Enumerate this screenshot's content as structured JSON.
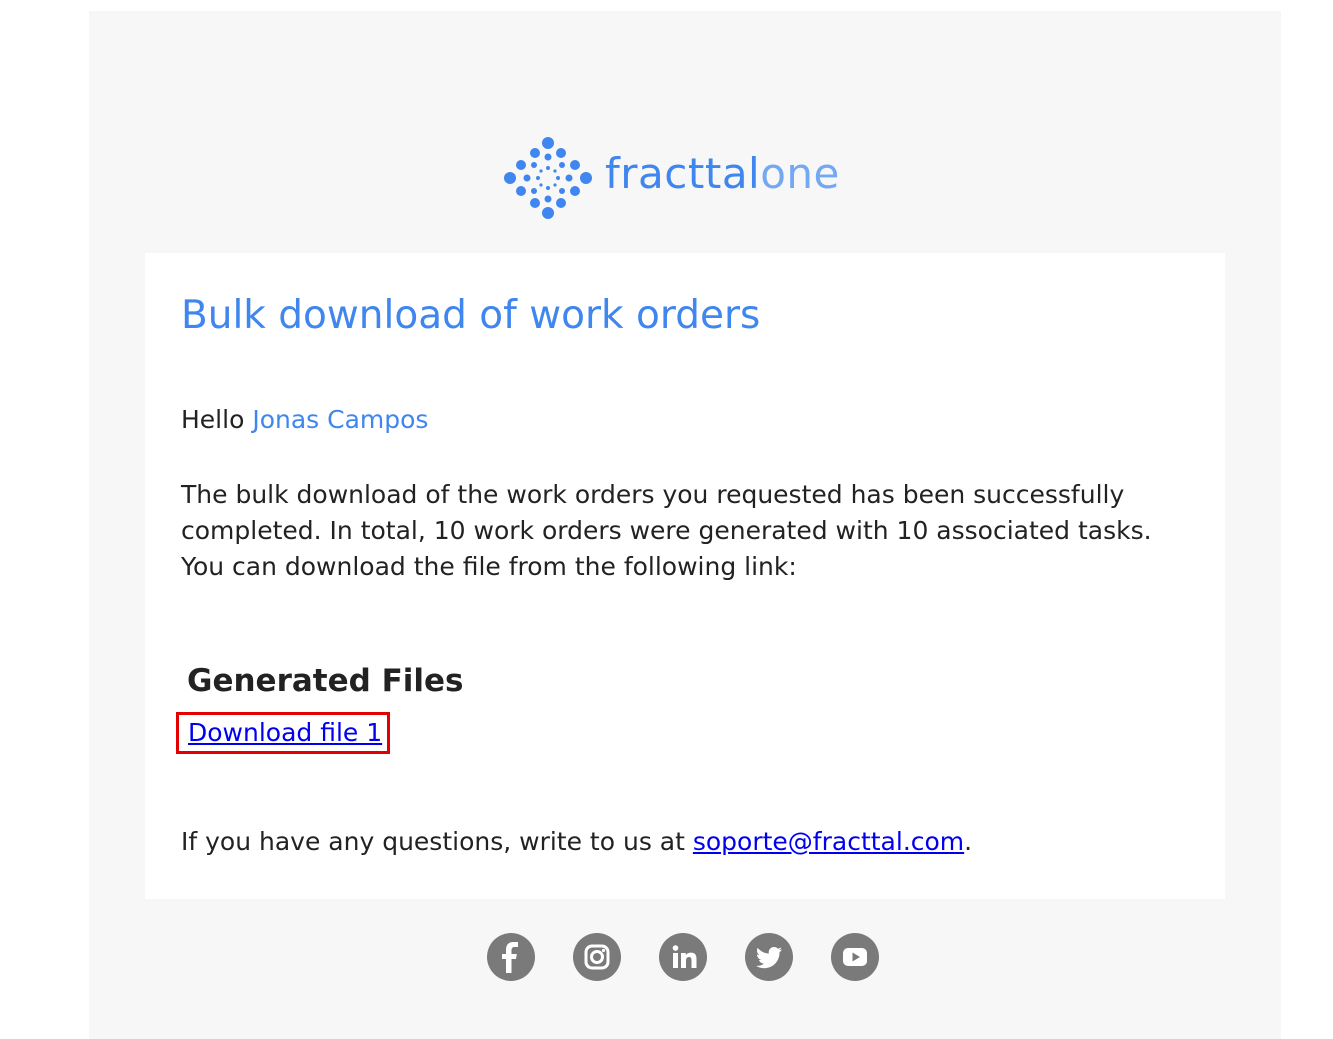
{
  "brand": {
    "name_primary": "fracttal",
    "name_secondary": "one",
    "color": "#3f86ee"
  },
  "email": {
    "title": "Bulk download of work orders",
    "greeting": "Hello",
    "recipient_name": "Jonas Campos",
    "message": "The bulk download of the work orders you requested has been successfully completed. In total, 10 work orders were generated with 10 associated tasks. You can download the file from the following link:",
    "files_heading": "Generated Files",
    "download_link_label": "Download file 1",
    "questions_prefix": "If you have any questions, write to us at ",
    "support_email": "soporte@fracttal.com",
    "questions_suffix": "."
  },
  "social_icons": [
    "facebook-icon",
    "instagram-icon",
    "linkedin-icon",
    "twitter-icon",
    "youtube-icon"
  ],
  "colors": {
    "link": "#0000ee",
    "highlight_box": "#e30000",
    "icon_gray": "#7a7a7a"
  }
}
